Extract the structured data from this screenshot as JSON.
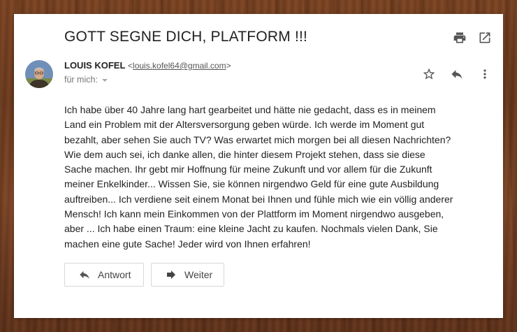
{
  "email": {
    "subject": "GOTT SEGNE DICH, PLATFORM !!!",
    "sender_name": "LOUIS KOFEL",
    "sender_email": "louis.kofel64@gmail.com",
    "recipient": "für mich:",
    "body": "Ich habe über 40 Jahre lang hart gearbeitet und hätte nie gedacht, dass es in meinem Land ein Problem mit der Altersversorgung geben würde. Ich werde im Moment gut bezahlt, aber sehen Sie auch TV? Was erwartet mich morgen bei all diesen Nachrichten? Wie dem auch sei, ich danke allen, die hinter diesem Projekt stehen, dass sie diese Sache machen. Ihr gebt mir Hoffnung für meine Zukunft und vor allem für die Zukunft meiner Enkelkinder... Wissen Sie, sie können nirgendwo Geld für eine gute Ausbildung auftreiben... Ich verdiene seit einem Monat bei Ihnen und fühle mich wie ein völlig anderer Mensch! Ich kann mein Einkommen von der Plattform im Moment nirgendwo ausgeben, aber ... Ich habe einen Traum: eine kleine Jacht zu kaufen. Nochmals vielen Dank, Sie machen eine gute Sache! Jeder wird von Ihnen erfahren!"
  },
  "buttons": {
    "reply_label": "Antwort",
    "forward_label": "Weiter"
  },
  "icons": {
    "print": "print-icon",
    "open_new": "open-in-new-icon",
    "star": "star-icon",
    "reply": "reply-icon",
    "more": "more-vert-icon",
    "caret": "caret-down-icon",
    "forward": "forward-icon"
  },
  "colors": {
    "icon": "#555555",
    "text": "#222222",
    "background_wood": "#6b3a1d"
  }
}
